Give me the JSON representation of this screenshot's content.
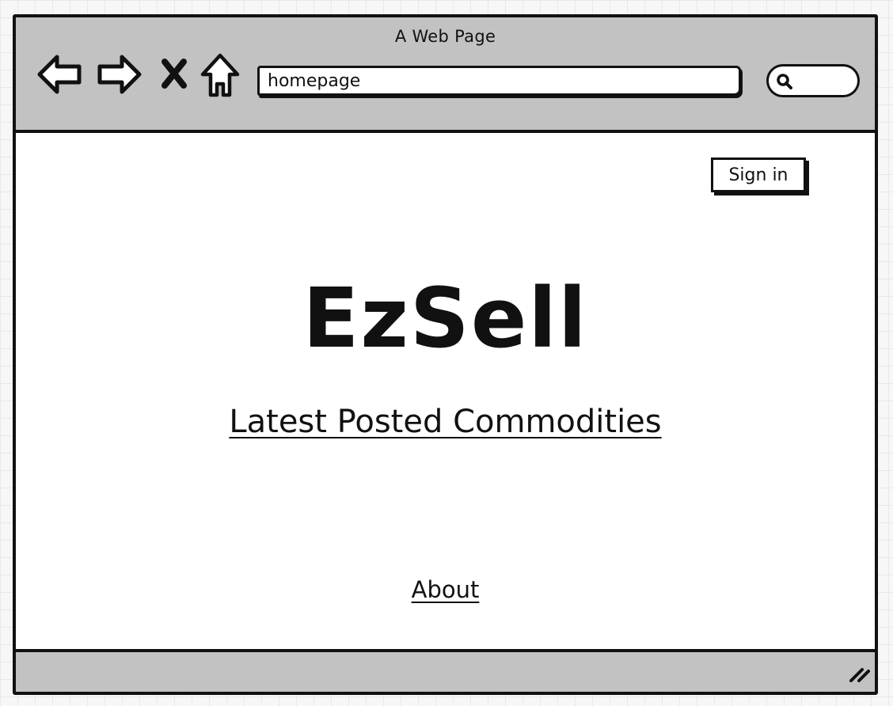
{
  "window": {
    "title": "A Web Page"
  },
  "toolbar": {
    "icons": [
      "back-arrow-icon",
      "forward-arrow-icon",
      "close-x-icon",
      "home-icon"
    ],
    "url_value": "homepage",
    "search_icon": "search-icon"
  },
  "header": {
    "signin_label": "Sign in"
  },
  "main": {
    "logo": "EzSell",
    "section_link": "Latest Posted Commodities",
    "about_link": "About"
  },
  "status_bar": {
    "icon": "resize-grip-icon"
  },
  "colors": {
    "chrome": "#c2c2c2",
    "border": "#111111",
    "page": "#ffffff"
  }
}
